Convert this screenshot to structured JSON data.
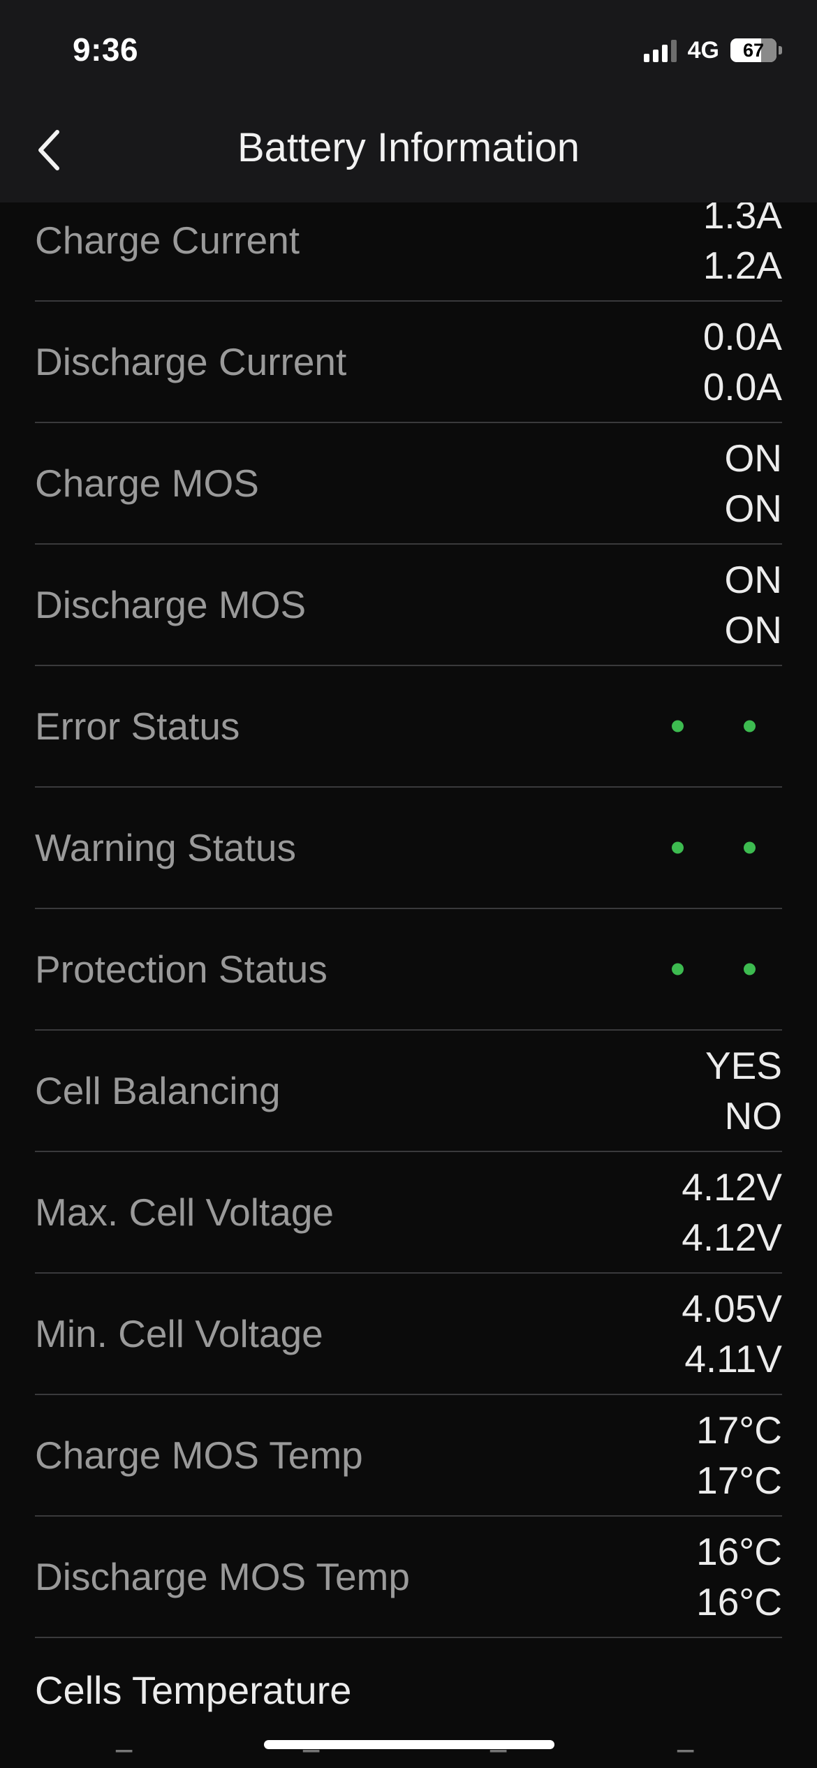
{
  "status_bar": {
    "time": "9:36",
    "network": "4G",
    "battery_level": "67"
  },
  "header": {
    "title": "Battery Information",
    "back_icon": "chevron-left-icon"
  },
  "colors": {
    "background": "#0b0b0b",
    "header_background": "#18181a",
    "status_ok": "#3dbb50"
  },
  "rows": [
    {
      "label": "Charge Current",
      "values": [
        "1.3A",
        "1.2A"
      ]
    },
    {
      "label": "Discharge Current",
      "values": [
        "0.0A",
        "0.0A"
      ]
    },
    {
      "label": "Charge MOS",
      "values": [
        "ON",
        "ON"
      ]
    },
    {
      "label": "Discharge MOS",
      "values": [
        "ON",
        "ON"
      ]
    },
    {
      "label": "Error Status",
      "indicators": [
        "green",
        "green"
      ]
    },
    {
      "label": "Warning Status",
      "indicators": [
        "green",
        "green"
      ]
    },
    {
      "label": "Protection Status",
      "indicators": [
        "green",
        "green"
      ]
    },
    {
      "label": "Cell Balancing",
      "values": [
        "YES",
        "NO"
      ]
    },
    {
      "label": "Max. Cell Voltage",
      "values": [
        "4.12V",
        "4.12V"
      ]
    },
    {
      "label": "Min. Cell Voltage",
      "values": [
        "4.05V",
        "4.11V"
      ]
    },
    {
      "label": "Charge MOS Temp",
      "values": [
        "17°C",
        "17°C"
      ]
    },
    {
      "label": "Discharge MOS Temp",
      "values": [
        "16°C",
        "16°C"
      ]
    }
  ],
  "cells_section": {
    "title": "Cells Temperature"
  }
}
